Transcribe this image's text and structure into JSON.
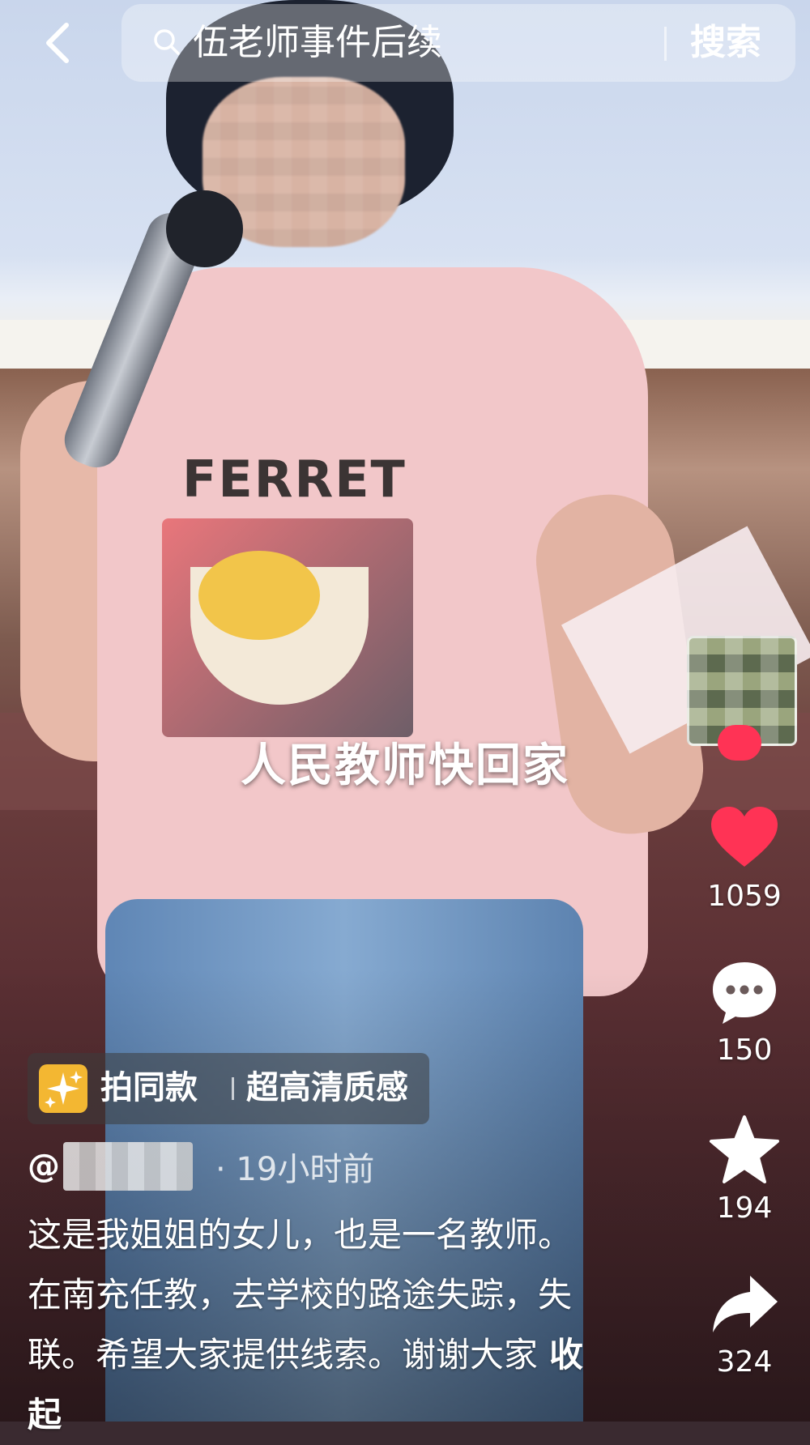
{
  "search": {
    "query": "伍老师事件后续",
    "button_label": "搜索"
  },
  "video": {
    "shirt_print_text": "FERRET",
    "caption": "人民教师快回家"
  },
  "actions": {
    "like_count": "1059",
    "comment_count": "150",
    "favorite_count": "194",
    "share_count": "324",
    "like_color": "#ff3355"
  },
  "template_chip": {
    "label_1": "拍同款",
    "label_2": "超高清质感"
  },
  "post": {
    "author_prefix": "@",
    "time": "· 19小时前",
    "description": "这是我姐姐的女儿，也是一名教师。在南充任教，去学校的路途失踪，失联。希望大家提供线索。谢谢大家",
    "collapse_label": "收起"
  }
}
